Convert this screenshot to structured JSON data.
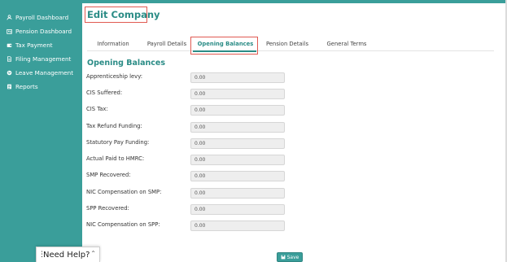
{
  "sidebar": {
    "items": [
      {
        "label": "Payroll Dashboard",
        "icon": "hand-coins-icon"
      },
      {
        "label": "Pension Dashboard",
        "icon": "id-card-icon"
      },
      {
        "label": "Tax Payment",
        "icon": "wallet-icon"
      },
      {
        "label": "Filing Management",
        "icon": "document-icon"
      },
      {
        "label": "Leave Management",
        "icon": "globe-icon"
      },
      {
        "label": "Reports",
        "icon": "report-icon"
      }
    ]
  },
  "page": {
    "title": "Edit Company"
  },
  "tabs": [
    {
      "label": "Information"
    },
    {
      "label": "Payroll Details"
    },
    {
      "label": "Opening Balances",
      "active": true
    },
    {
      "label": "Pension Details"
    },
    {
      "label": "General Terms"
    }
  ],
  "section": {
    "title": "Opening Balances"
  },
  "fields": [
    {
      "label": "Apprenticeship levy:",
      "value": "0.00"
    },
    {
      "label": "CIS Suffered:",
      "value": "0.00"
    },
    {
      "label": "CIS Tax:",
      "value": "0.00"
    },
    {
      "label": "Tax Refund Funding:",
      "value": "0.00"
    },
    {
      "label": "Statutory Pay Funding:",
      "value": "0.00"
    },
    {
      "label": "Actual Paid to HMRC:",
      "value": "0.00"
    },
    {
      "label": "SMP Recovered:",
      "value": "0.00"
    },
    {
      "label": "NIC Compensation on SMP:",
      "value": "0.00"
    },
    {
      "label": "SPP Recovered:",
      "value": "0.00"
    },
    {
      "label": "NIC Compensation on SPP:",
      "value": "0.00"
    }
  ],
  "actions": {
    "save_label": "Save",
    "save_icon": "floppy-disk-icon"
  },
  "help": {
    "label": "Need Help?"
  },
  "colors": {
    "brand": "#3a9e9a",
    "accent_text": "#2b8c86",
    "highlight": "#e05a52"
  }
}
